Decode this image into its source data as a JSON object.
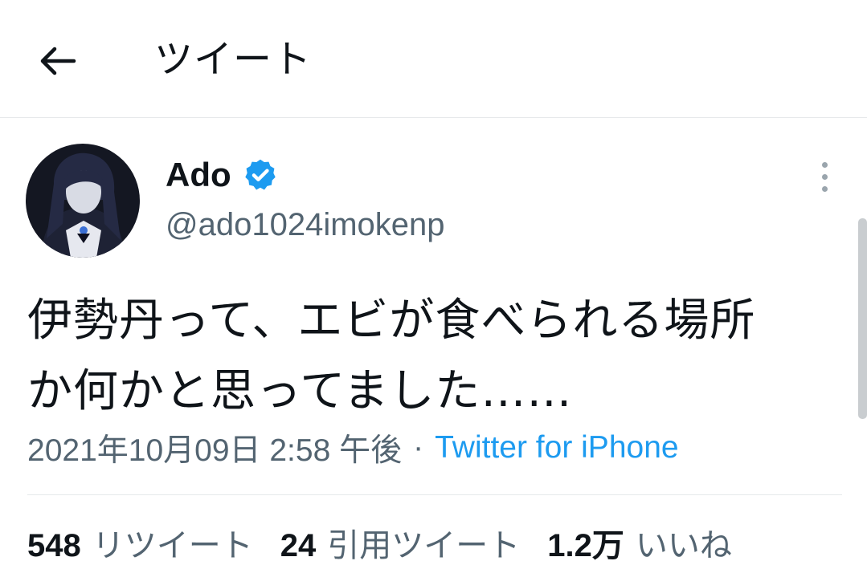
{
  "header": {
    "back_icon": "arrow-left-icon",
    "title": "ツイート"
  },
  "author": {
    "display_name": "Ado",
    "verified_icon": "verified-badge-icon",
    "verified_color": "#1d9bf0",
    "handle": "@ado1024imokenp",
    "more_icon": "more-vertical-icon"
  },
  "tweet": {
    "text_line1": "伊勢丹って、エビが食べられる場所",
    "text_line2": "か何かと思ってました……",
    "timestamp": "2021年10月09日 2:58 午後",
    "separator": "·",
    "source": "Twitter for iPhone"
  },
  "stats": {
    "retweets_count": "548",
    "retweets_label": "リツイート",
    "quotes_count": "24",
    "quotes_label": "引用ツイート",
    "likes_count": "1.2万",
    "likes_label": "いいね"
  },
  "colors": {
    "link": "#1d9bf0",
    "secondary_text": "#536471",
    "primary_text": "#0f1419"
  }
}
